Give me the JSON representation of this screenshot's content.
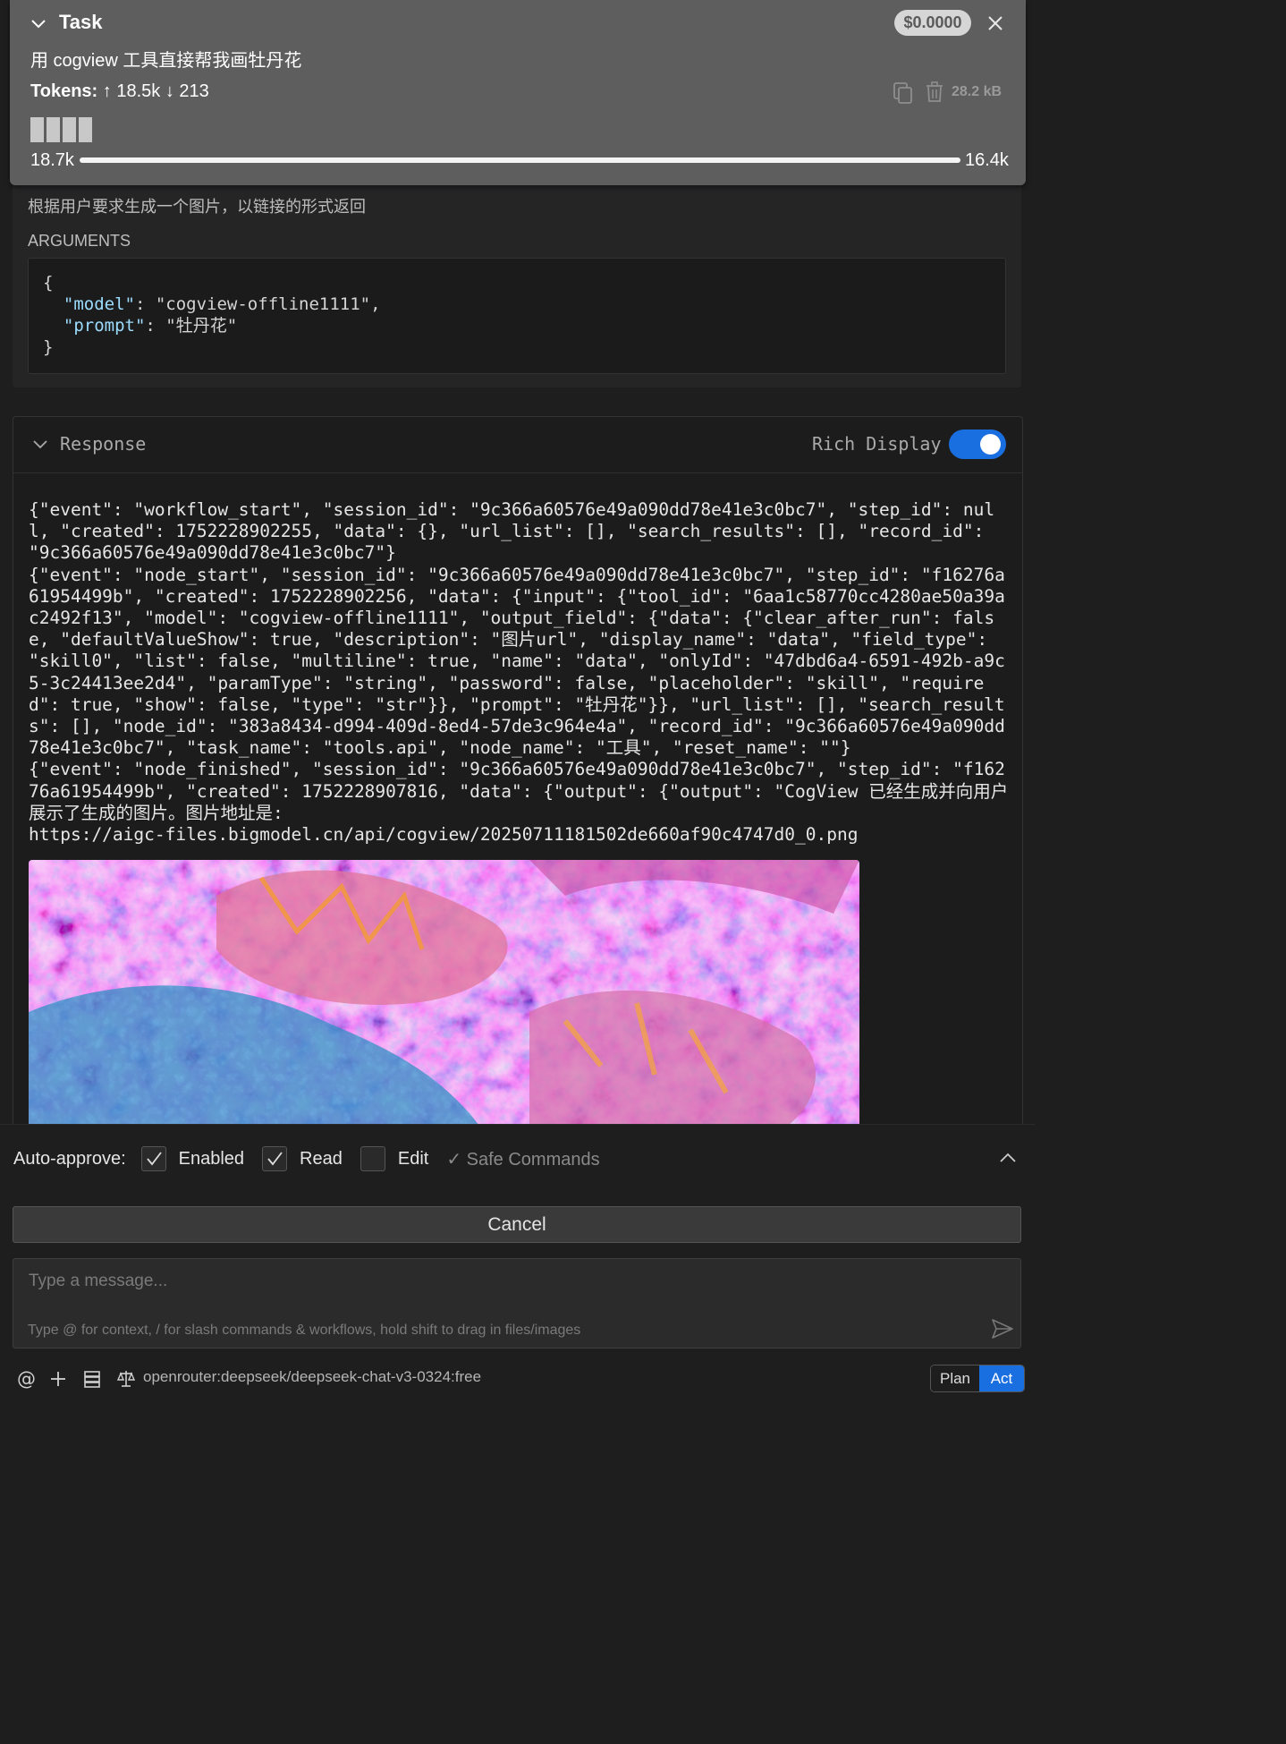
{
  "task": {
    "title": "Task",
    "cost": "$0.0000",
    "prompt": "用 cogview 工具直接帮我画牡丹花",
    "tokens_label": "Tokens:",
    "tokens_in": "18.5k",
    "tokens_out": "213",
    "size": "28.2 kB",
    "context_used": "18.7k",
    "context_max": "16.4k",
    "context_fill": 1.0
  },
  "tool": {
    "description": "根据用户要求生成一个图片，以链接的形式返回",
    "arguments_label": "ARGUMENTS",
    "arg_model_key": "\"model\"",
    "arg_model_value": "\"cogview-offline1111\"",
    "arg_prompt_key": "\"prompt\"",
    "arg_prompt_value": "\"牡丹花\""
  },
  "response": {
    "title": "Response",
    "rich_display_label": "Rich Display",
    "rich_display_on": true,
    "lines": [
      "{\"event\": \"workflow_start\", \"session_id\": \"9c366a60576e49a090dd78e41e3c0bc7\", \"step_id\": nul",
      "l, \"created\": 1752228902255, \"data\": {}, \"url_list\": [], \"search_results\": [], \"record_id\":",
      "\"9c366a60576e49a090dd78e41e3c0bc7\"}",
      "{\"event\": \"node_start\", \"session_id\": \"9c366a60576e49a090dd78e41e3c0bc7\", \"step_id\": \"f16276a",
      "61954499b\", \"created\": 1752228902256, \"data\": {\"input\": {\"tool_id\": \"6aa1c58770cc4280ae50a39a",
      "c2492f13\", \"model\": \"cogview-offline1111\", \"output_field\": {\"data\": {\"clear_after_run\": fals",
      "e, \"defaultValueShow\": true, \"description\": \"图片url\", \"display_name\": \"data\", \"field_type\":",
      "\"skill0\", \"list\": false, \"multiline\": true, \"name\": \"data\", \"onlyId\": \"47dbd6a4-6591-492b-a9c",
      "5-3c24413ee2d4\", \"paramType\": \"string\", \"password\": false, \"placeholder\": \"skill\", \"require",
      "d\": true, \"show\": false, \"type\": \"str\"}}, \"prompt\": \"牡丹花\"}}, \"url_list\": [], \"search_result",
      "s\": [], \"node_id\": \"383a8434-d994-409d-8ed4-57de3c964e4a\", \"record_id\": \"9c366a60576e49a090dd",
      "78e41e3c0bc7\", \"task_name\": \"tools.api\", \"node_name\": \"工具\", \"reset_name\": \"\"}",
      "{\"event\": \"node_finished\", \"session_id\": \"9c366a60576e49a090dd78e41e3c0bc7\", \"step_id\": \"f162",
      "76a61954499b\", \"created\": 1752228907816, \"data\": {\"output\": {\"output\": \"CogView 已经生成并向用户",
      "展示了生成的图片。图片地址是:",
      "https://aigc-files.bigmodel.cn/api/cogview/20250711181502de660af90c4747d0_0.png"
    ],
    "image_icon": "generated-peony-image"
  },
  "auto_approve": {
    "label": "Auto-approve:",
    "items": [
      {
        "label": "Enabled",
        "checked": true
      },
      {
        "label": "Read",
        "checked": true
      },
      {
        "label": "Edit",
        "checked": false
      }
    ],
    "safe_commands": "✓ Safe Commands"
  },
  "cancel_label": "Cancel",
  "input": {
    "placeholder": "Type a message...",
    "hint": "Type @ for context, / for slash commands & workflows, hold shift to drag in files/images"
  },
  "footer": {
    "model": "openrouter:deepseek/deepseek-chat-v3-0324:free",
    "mode_plan": "Plan",
    "mode_act": "Act",
    "active_mode": "Act"
  },
  "colors": {
    "accent": "#1a6fe0",
    "header_bg": "#5e5e5e",
    "json_key": "#9cdcfe"
  }
}
